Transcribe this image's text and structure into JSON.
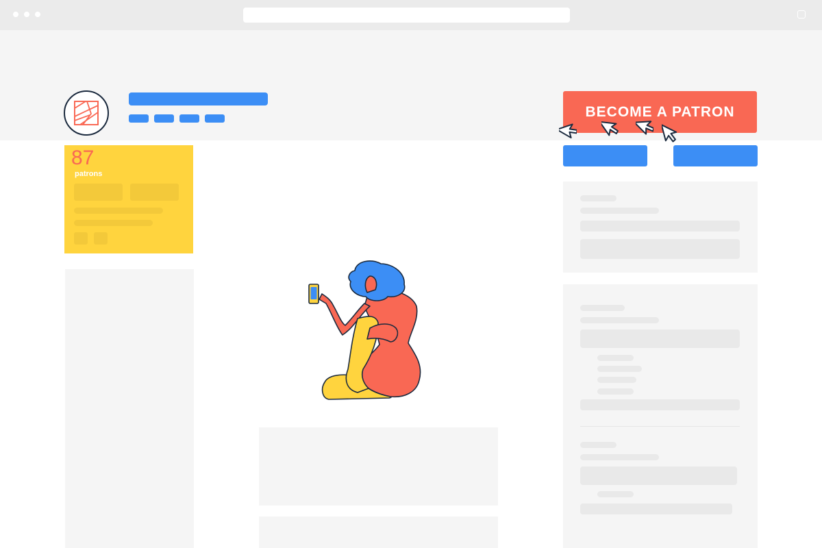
{
  "colors": {
    "accent": "#f96854",
    "blue": "#3c8ef5",
    "yellow": "#ffd43e",
    "panel": "#f5f5f5",
    "placeholder": "#e9e9e9",
    "navy": "#1b2a3e"
  },
  "header": {
    "cta_label": "BECOME A PATRON"
  },
  "stats": {
    "count": "87",
    "label": "patrons"
  },
  "icons": {
    "avatar": "creator-logo-icon",
    "cursor": "mouse-pointer-icon"
  },
  "illustration": "woman-sitting-with-phone"
}
